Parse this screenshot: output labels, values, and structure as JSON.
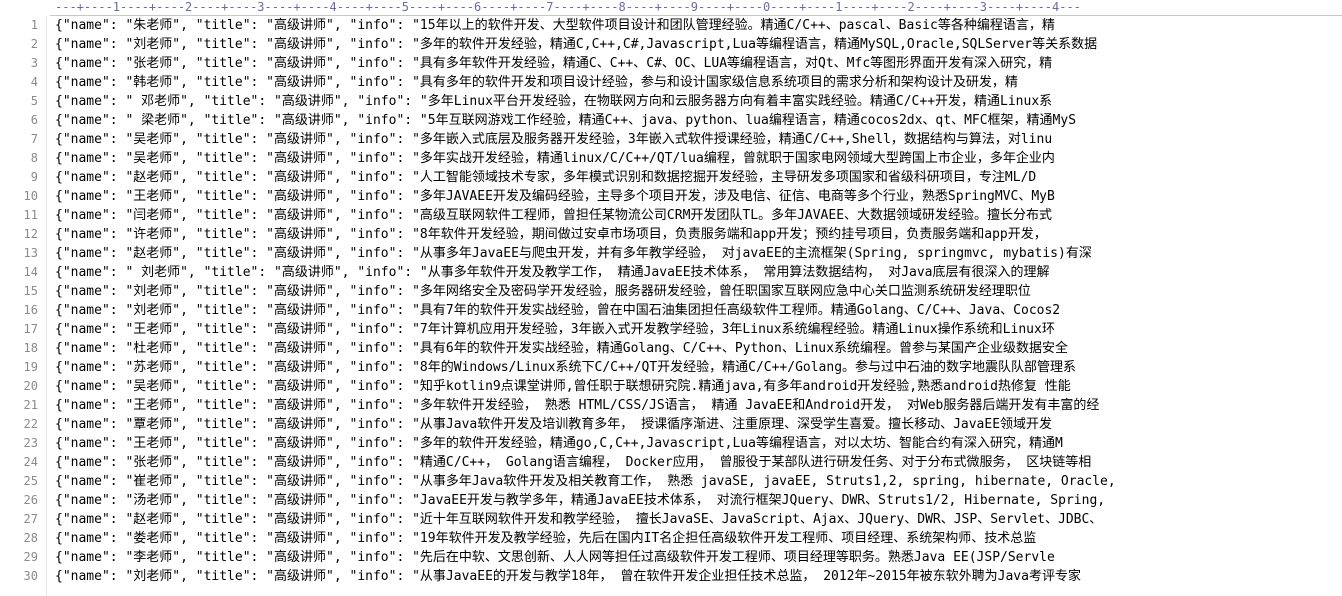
{
  "ruler": {
    "text": "---+----1----+----2----+----3----+----4----+----5----+----6----+----7----+----8----+----9----+----0----+----1----+----2----+----3----+----4---"
  },
  "lines": [
    {
      "num": "1",
      "text": "{\"name\": \"朱老师\", \"title\": \"高级讲师\", \"info\": \"15年以上的软件开发、大型软件项目设计和团队管理经验。精通C/C++、pascal、Basic等各种编程语言，精"
    },
    {
      "num": "2",
      "text": "{\"name\": \"刘老师\", \"title\": \"高级讲师\", \"info\": \"多年的软件开发经验，精通C,C++,C#,Javascript,Lua等编程语言，精通MySQL,Oracle,SQLServer等关系数据"
    },
    {
      "num": "3",
      "text": "{\"name\": \"张老师\", \"title\": \"高级讲师\", \"info\": \"具有多年软件开发经验，精通C、C++、C#、OC、LUA等编程语言，对Qt、Mfc等图形界面开发有深入研究，精"
    },
    {
      "num": "4",
      "text": "{\"name\": \"韩老师\", \"title\": \"高级讲师\", \"info\": \"具有多年的软件开发和项目设计经验，参与和设计国家级信息系统项目的需求分析和架构设计及研发，精"
    },
    {
      "num": "5",
      "text": "{\"name\": \" 邓老师\", \"title\": \"高级讲师\", \"info\": \"多年Linux平台开发经验，在物联网方向和云服务器方向有着丰富实践经验。精通C/C++开发，精通Linux系"
    },
    {
      "num": "6",
      "text": "{\"name\": \" 梁老师\", \"title\": \"高级讲师\", \"info\": \"5年互联网游戏工作经验，精通C++、java、python、lua编程语言，精通cocos2dx、qt、MFC框架，精通MyS"
    },
    {
      "num": "7",
      "text": "{\"name\": \"吴老师\", \"title\": \"高级讲师\", \"info\": \"多年嵌入式底层及服务器开发经验，3年嵌入式软件授课经验，精通C/C++,Shell，数据结构与算法，对linu"
    },
    {
      "num": "8",
      "text": "{\"name\": \"吴老师\", \"title\": \"高级讲师\", \"info\": \"多年实战开发经验，精通linux/C/C++/QT/lua编程，曾就职于国家电网领域大型跨国上市企业，多年企业内"
    },
    {
      "num": "9",
      "text": "{\"name\": \"赵老师\", \"title\": \"高级讲师\", \"info\": \"人工智能领域技术专家，多年模式识别和数据挖掘开发经验，主导研发多项国家和省级科研项目，专注ML/D"
    },
    {
      "num": "10",
      "text": "{\"name\": \"王老师\", \"title\": \"高级讲师\", \"info\": \"多年JAVAEE开发及编码经验，主导多个项目开发，涉及电信、征信、电商等多个行业，熟悉SpringMVC、MyB"
    },
    {
      "num": "11",
      "text": "{\"name\": \"闫老师\", \"title\": \"高级讲师\", \"info\": \"高级互联网软件工程师，曾担任某物流公司CRM开发团队TL。多年JAVAEE、大数据领域研发经验。擅长分布式"
    },
    {
      "num": "12",
      "text": "{\"name\": \"许老师\", \"title\": \"高级讲师\", \"info\": \"8年软件开发经验，期间做过安卓市场项目，负责服务端和app开发；预约挂号项目，负责服务端和app开发，"
    },
    {
      "num": "13",
      "text": "{\"name\": \"赵老师\", \"title\": \"高级讲师\", \"info\": \"从事多年JavaEE与爬虫开发，并有多年教学经验， 对javaEE的主流框架(Spring, springmvc, mybatis)有深"
    },
    {
      "num": "14",
      "text": "{\"name\": \" 刘老师\", \"title\": \"高级讲师\", \"info\": \"从事多年软件开发及教学工作， 精通JavaEE技术体系， 常用算法数据结构， 对Java底层有很深入的理解"
    },
    {
      "num": "15",
      "text": "{\"name\": \"刘老师\", \"title\": \"高级讲师\", \"info\": \"多年网络安全及密码学开发经验，服务器研发经验，曾任职国家互联网应急中心关口监测系统研发经理职位"
    },
    {
      "num": "16",
      "text": "{\"name\": \"刘老师\", \"title\": \"高级讲师\", \"info\": \"具有7年的软件开发实战经验，曾在中国石油集团担任高级软件工程师。精通Golang、C/C++、Java、Cocos2"
    },
    {
      "num": "17",
      "text": "{\"name\": \"王老师\", \"title\": \"高级讲师\", \"info\": \"7年计算机应用开发经验，3年嵌入式开发教学经验，3年Linux系统编程经验。精通Linux操作系统和Linux环"
    },
    {
      "num": "18",
      "text": "{\"name\": \"杜老师\", \"title\": \"高级讲师\", \"info\": \"具有6年的软件开发实战经验，精通Golang、C/C++、Python、Linux系统编程。曾参与某国产企业级数据安全"
    },
    {
      "num": "19",
      "text": "{\"name\": \"苏老师\", \"title\": \"高级讲师\", \"info\": \"8年的Windows/Linux系统下C/C++/QT开发经验，精通C/C++/Golang。参与过中石油的数字地震队队部管理系"
    },
    {
      "num": "20",
      "text": "{\"name\": \"吴老师\", \"title\": \"高级讲师\", \"info\": \"知乎kotlin9点课堂讲师,曾任职于联想研究院.精通java,有多年android开发经验,熟悉android热修复 性能"
    },
    {
      "num": "21",
      "text": "{\"name\": \"王老师\", \"title\": \"高级讲师\", \"info\": \"多年软件开发经验， 熟悉 HTML/CSS/JS语言， 精通 JavaEE和Android开发， 对Web服务器后端开发有丰富的经"
    },
    {
      "num": "22",
      "text": "{\"name\": \"覃老师\", \"title\": \"高级讲师\", \"info\": \"从事Java软件开发及培训教育多年， 授课循序渐进、注重原理、深受学生喜爱。擅长移动、JavaEE领域开发"
    },
    {
      "num": "23",
      "text": "{\"name\": \"王老师\", \"title\": \"高级讲师\", \"info\": \"多年的软件开发经验，精通go,C,C++,Javascript,Lua等编程语言，对以太坊、智能合约有深入研究，精通M"
    },
    {
      "num": "24",
      "text": "{\"name\": \"张老师\", \"title\": \"高级讲师\", \"info\": \"精通C/C++， Golang语言编程， Docker应用， 曾服役于某部队进行研发任务、对于分布式微服务， 区块链等相"
    },
    {
      "num": "25",
      "text": "{\"name\": \"崔老师\", \"title\": \"高级讲师\", \"info\": \"从事多年Java软件开发及相关教育工作， 熟悉 javaSE, javaEE, Struts1,2, spring, hibernate, Oracle, "
    },
    {
      "num": "26",
      "text": "{\"name\": \"汤老师\", \"title\": \"高级讲师\", \"info\": \"JavaEE开发与教学多年，精通JavaEE技术体系， 对流行框架JQuery、DWR、Struts1/2, Hibernate, Spring,"
    },
    {
      "num": "27",
      "text": "{\"name\": \"赵老师\", \"title\": \"高级讲师\", \"info\": \"近十年互联网软件开发和教学经验， 擅长JavaSE、JavaScript、Ajax、JQuery、DWR、JSP、Servlet、JDBC、"
    },
    {
      "num": "28",
      "text": "{\"name\": \"娄老师\", \"title\": \"高级讲师\", \"info\": \"19年软件开发及教学经验，先后在国内IT名企担任高级软件开发工程师、项目经理、系统架构师、技术总监"
    },
    {
      "num": "29",
      "text": "{\"name\": \"李老师\", \"title\": \"高级讲师\", \"info\": \"先后在中软、文思创新、人人网等担任过高级软件开发工程师、项目经理等职务。熟悉Java EE(JSP/Servle"
    },
    {
      "num": "30",
      "text": "{\"name\": \"刘老师\", \"title\": \"高级讲师\", \"info\": \"从事JavaEE的开发与教学18年， 曾在软件开发企业担任技术总监， 2012年~2015年被东软外聘为Java考评专家"
    }
  ]
}
